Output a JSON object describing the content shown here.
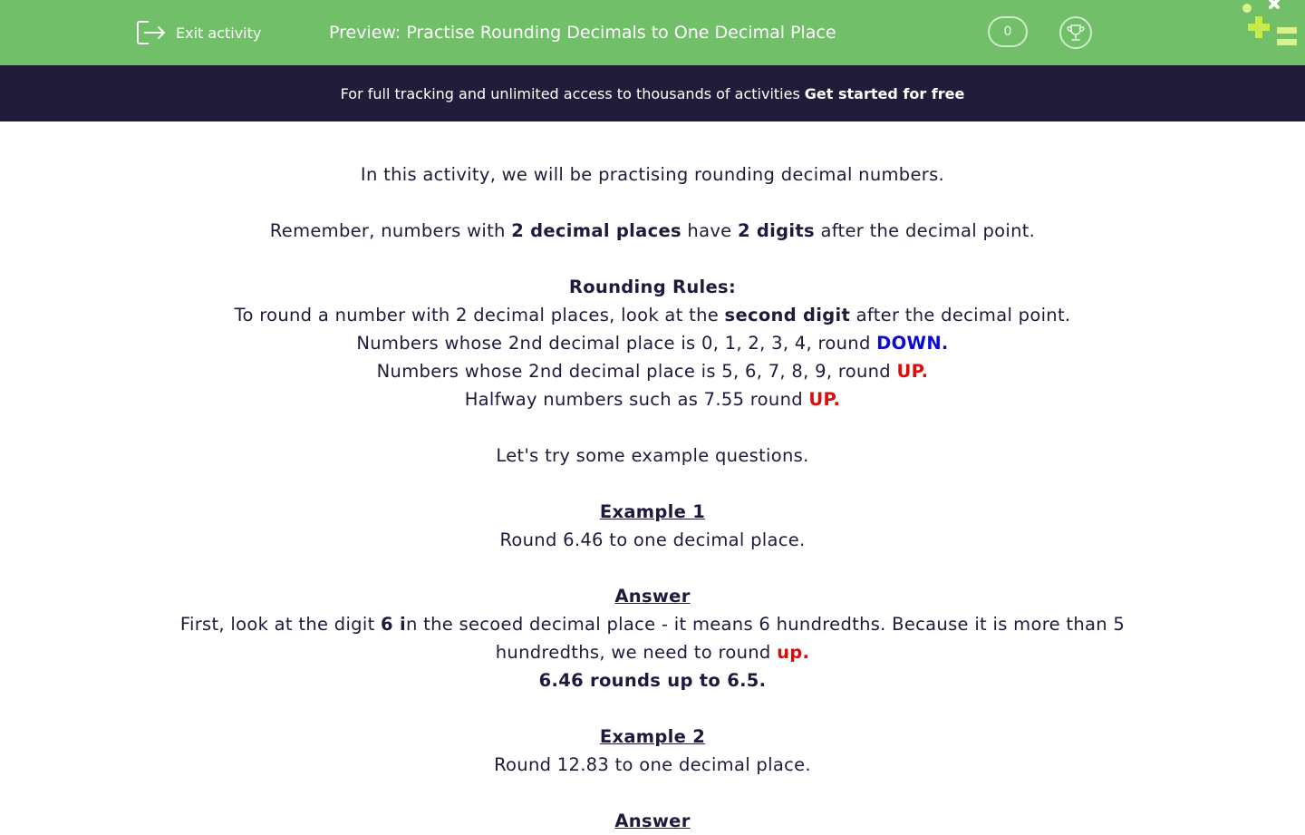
{
  "header": {
    "exit_label": "Exit activity",
    "title": "Preview: Practise Rounding Decimals to One Decimal Place",
    "score": "0",
    "bg_color": "#72bf6a"
  },
  "banner": {
    "text": "For full tracking and unlimited access to thousands of activities",
    "cta": "Get started for free"
  },
  "content": {
    "intro": "In this activity, we will be practising rounding decimal numbers.",
    "remember": {
      "a": "Remember, numbers with ",
      "b1": "2 decimal places",
      "c": " have ",
      "b2": "2 digits",
      "d": " after the decimal point."
    },
    "rules_heading": "Rounding Rules:",
    "rule1": {
      "a": "To round a number with 2 decimal places, look at the ",
      "b": "second digit",
      "c": " after the decimal point."
    },
    "rule2": {
      "a": "Numbers whose 2nd decimal place is 0, 1, 2, 3, 4, round ",
      "b": "DOWN."
    },
    "rule3": {
      "a": "Numbers whose 2nd decimal place is 5, 6, 7, 8, 9, round ",
      "b": "UP."
    },
    "rule4": {
      "a": "Halfway numbers such as 7.55 round ",
      "b": "UP."
    },
    "try": "Let's try some example questions.",
    "example1": {
      "heading": "Example 1",
      "question": "Round 6.46 to one decimal place.",
      "answer_heading": "Answer",
      "answer": {
        "a": "First, look at the digit ",
        "b": "6 i",
        "c": "n the secoed decimal place - it means 6 hundredths. Because it is more than 5 hundredths, we need to round ",
        "d": "up."
      },
      "result": "6.46 rounds up to 6.5."
    },
    "example2": {
      "heading": "Example 2",
      "question": "Round 12.83 to one decimal place.",
      "answer_heading": "Answer"
    }
  }
}
